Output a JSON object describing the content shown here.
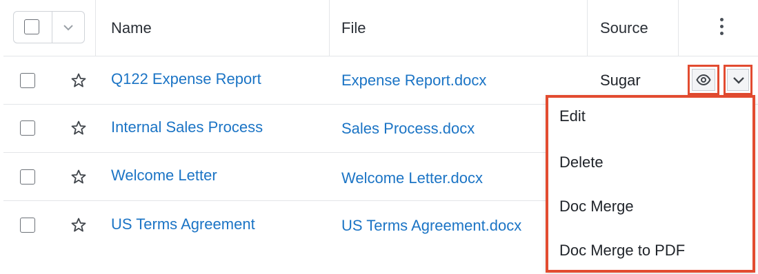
{
  "table": {
    "columns": {
      "name": "Name",
      "file": "File",
      "source": "Source"
    },
    "rows": [
      {
        "name": "Q122 Expense Report",
        "file": "Expense Report.docx",
        "source": "Sugar"
      },
      {
        "name": "Internal Sales Process",
        "file": "Sales Process.docx",
        "source": ""
      },
      {
        "name": "Welcome Letter",
        "file": "Welcome Letter.docx",
        "source": ""
      },
      {
        "name": "US Terms Agreement",
        "file": "US Terms Agreement.docx",
        "source": ""
      }
    ]
  },
  "row_actions_menu": {
    "items": [
      "Edit",
      "Delete",
      "Doc Merge",
      "Doc Merge to PDF"
    ]
  },
  "colors": {
    "link": "#1b74c5",
    "highlight": "#e24b30",
    "border": "#e3e5e8"
  },
  "icons": {
    "header": [
      "checkbox",
      "chevron-down-icon",
      "kebab-menu-icon"
    ],
    "row": [
      "checkbox",
      "star-icon",
      "eye-icon",
      "chevron-down-icon"
    ]
  }
}
